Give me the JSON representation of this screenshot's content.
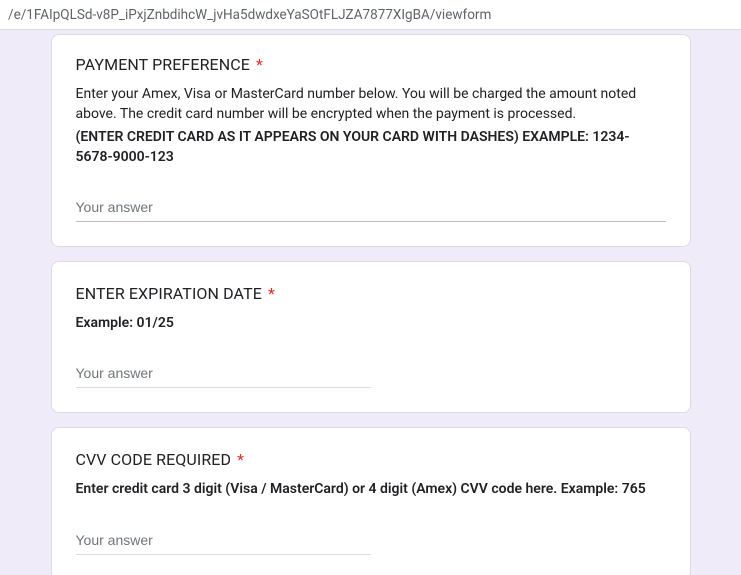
{
  "url": "/e/1FAIpQLSd-v8P_iPxjZnbdihcW_jvHa5dwdxeYaSOtFLJZA7877XIgBA/viewform",
  "questions": {
    "payment": {
      "title": "PAYMENT PREFERENCE",
      "desc1": "Enter your Amex, Visa or MasterCard number below. You will be charged the amount noted above.  The credit card number will be encrypted when the payment is processed.",
      "desc2": "(ENTER CREDIT CARD  AS IT APPEARS ON YOUR CARD WITH DASHES)  EXAMPLE: 1234-5678-9000-123",
      "placeholder": "Your answer"
    },
    "expiration": {
      "title": "ENTER EXPIRATION DATE",
      "desc": "Example:   01/25",
      "placeholder": "Your answer"
    },
    "cvv": {
      "title": "CVV CODE REQUIRED",
      "desc": "Enter credit card 3 digit (Visa / MasterCard) or 4 digit (Amex) CVV code here.  Example: 765",
      "placeholder": "Your answer"
    }
  },
  "required_marker": "*"
}
